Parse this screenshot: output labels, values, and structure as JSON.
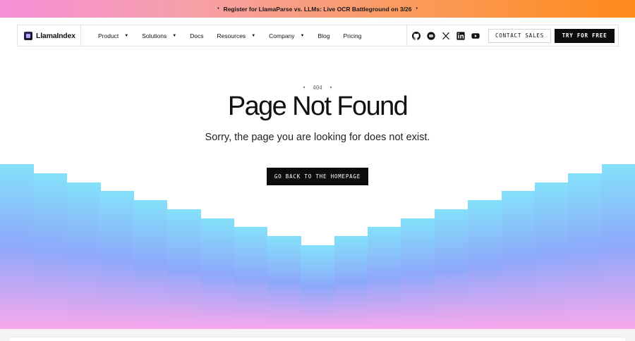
{
  "banner": {
    "text": "Register for LlamaParse vs. LLMs: Live OCR Battleground on 3/26",
    "dot": "•"
  },
  "nav": {
    "logo_text": "LlamaIndex",
    "menu": [
      {
        "label": "Product",
        "has_dropdown": true
      },
      {
        "label": "Solutions",
        "has_dropdown": true
      },
      {
        "label": "Docs",
        "has_dropdown": false
      },
      {
        "label": "Resources",
        "has_dropdown": true
      },
      {
        "label": "Company",
        "has_dropdown": true
      },
      {
        "label": "Blog",
        "has_dropdown": false
      },
      {
        "label": "Pricing",
        "has_dropdown": false
      }
    ],
    "caret": "▼",
    "socials": [
      "github-icon",
      "discord-icon",
      "x-icon",
      "linkedin-icon",
      "youtube-icon"
    ],
    "contact_label": "CONTACT SALES",
    "try_label": "TRY FOR FREE"
  },
  "hero": {
    "code": "404",
    "title": "Page Not Found",
    "subtitle": "Sorry, the page you are looking for does not exist.",
    "button_label": "GO BACK TO THE HOMEPAGE"
  },
  "colors": {
    "banner_start": "#f48fd8",
    "banner_end": "#ff8a1a",
    "bar_top": "#84e1fa",
    "bar_mid": "#8ea8fb",
    "bar_bottom": "#f8a8ec",
    "button_dark": "#0c0c0c"
  }
}
